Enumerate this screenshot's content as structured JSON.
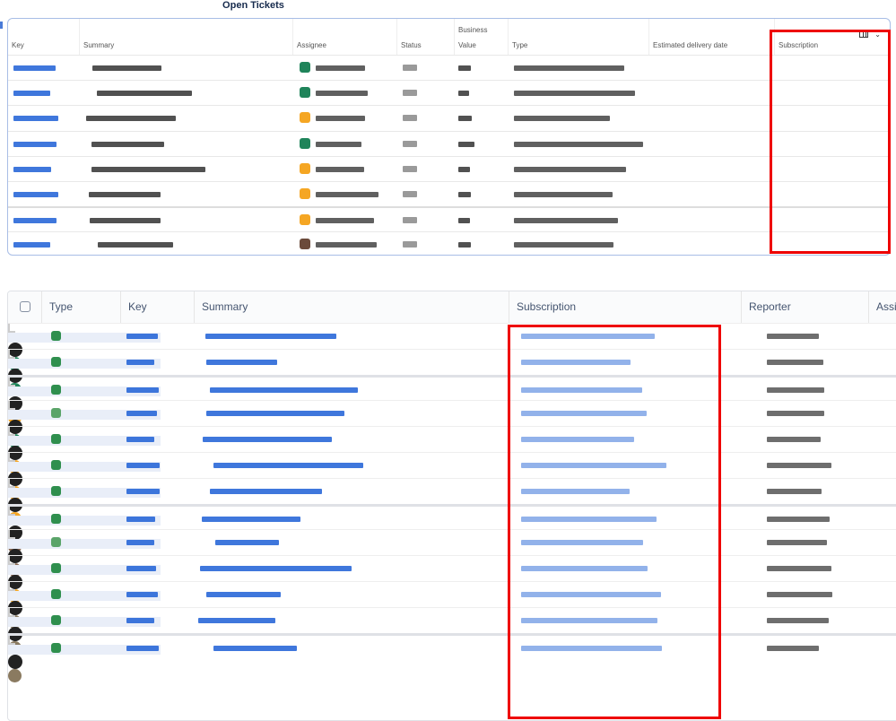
{
  "title": "Open Tickets",
  "top_table": {
    "headers": [
      "Key",
      "Summary",
      "Assignee",
      "Status",
      "Value",
      "Type",
      "Estimated delivery date",
      "Subscription"
    ],
    "business_label": "Business",
    "row_count": 8
  },
  "bottom_table": {
    "headers": [
      "Type",
      "Key",
      "Summary",
      "Subscription",
      "Reporter",
      "Assi"
    ],
    "row_count": 13
  },
  "colors": {
    "link": "#1d5fd6",
    "highlight": "#e00000",
    "green": "#1f845a",
    "orange": "#f5a623"
  }
}
